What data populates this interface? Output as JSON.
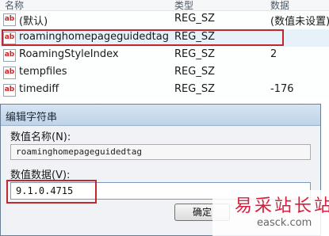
{
  "columns": {
    "name": "名称",
    "type": "类型",
    "data": "数据"
  },
  "rows": [
    {
      "icon": "ab",
      "name": "(默认)",
      "type": "REG_SZ",
      "data": "(数值未设置)"
    },
    {
      "icon": "ab",
      "name": "roaminghomepageguidedtag",
      "type": "REG_SZ",
      "data": ""
    },
    {
      "icon": "ab",
      "name": "RoamingStyleIndex",
      "type": "REG_SZ",
      "data": "2"
    },
    {
      "icon": "ab",
      "name": "tempfiles",
      "type": "REG_SZ",
      "data": ""
    },
    {
      "icon": "ab",
      "name": "timediff",
      "type": "REG_SZ",
      "data": "-176"
    }
  ],
  "dialog": {
    "title": "编辑字符串",
    "value_name_label": "数值名称(N):",
    "value_name": "roaminghomepageguidedtag",
    "value_data_label": "数值数据(V):",
    "value_data": "9.1.0.4715",
    "ok_label": "确定"
  },
  "watermark": {
    "cn": "易采站长站",
    "en": "easck.com"
  },
  "colors": {
    "highlight_box": "#c0282d",
    "list_selected": "#e6f1fa",
    "watermark": "#d81e3c"
  }
}
